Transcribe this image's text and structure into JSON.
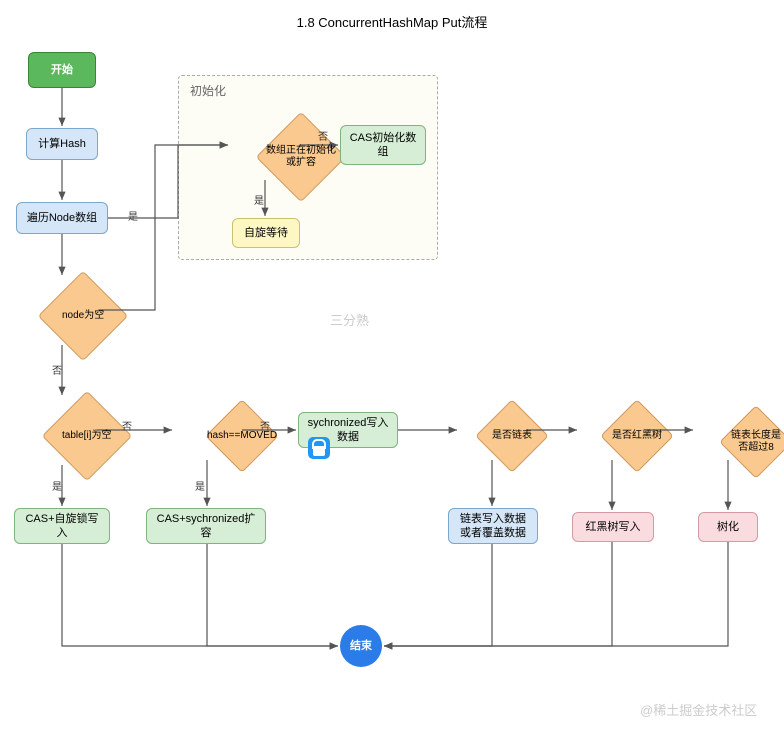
{
  "chart_data": {
    "type": "flowchart",
    "title": "1.8 ConcurrentHashMap Put流程",
    "nodes": [
      {
        "id": "start",
        "type": "terminator",
        "label": "开始"
      },
      {
        "id": "calc_hash",
        "type": "process",
        "label": "计算Hash"
      },
      {
        "id": "iterate",
        "type": "process",
        "label": "遍历Node数组"
      },
      {
        "id": "node_empty",
        "type": "decision",
        "label": "node为空"
      },
      {
        "id": "init_group",
        "type": "container",
        "label": "初始化"
      },
      {
        "id": "init_decide",
        "type": "decision",
        "label": "数组正在初始化或扩容"
      },
      {
        "id": "cas_init",
        "type": "process",
        "label": "CAS初始化数组"
      },
      {
        "id": "spin_wait",
        "type": "process",
        "label": "自旋等待"
      },
      {
        "id": "table_empty",
        "type": "decision",
        "label": "table[i]为空"
      },
      {
        "id": "hash_moved",
        "type": "decision",
        "label": "hash==MOVED"
      },
      {
        "id": "sync_write",
        "type": "process",
        "label": "sychronized写入数据"
      },
      {
        "id": "is_list",
        "type": "decision",
        "label": "是否链表"
      },
      {
        "id": "is_rbtree",
        "type": "decision",
        "label": "是否红黑树"
      },
      {
        "id": "len_gt8",
        "type": "decision",
        "label": "链表长度是否超过8"
      },
      {
        "id": "cas_spin_write",
        "type": "process",
        "label": "CAS+自旋锁写入"
      },
      {
        "id": "cas_sync_resize",
        "type": "process",
        "label": "CAS+sychronized扩容"
      },
      {
        "id": "list_write",
        "type": "process",
        "label": "链表写入数据或者覆盖数据"
      },
      {
        "id": "rbtree_write",
        "type": "process",
        "label": "红黑树写入"
      },
      {
        "id": "treeify",
        "type": "process",
        "label": "树化"
      },
      {
        "id": "end",
        "type": "terminator",
        "label": "结束"
      }
    ],
    "edges": [
      {
        "from": "start",
        "to": "calc_hash"
      },
      {
        "from": "calc_hash",
        "to": "iterate"
      },
      {
        "from": "iterate",
        "to": "node_empty"
      },
      {
        "from": "node_empty",
        "to": "init_decide",
        "label": "是"
      },
      {
        "from": "init_decide",
        "to": "cas_init",
        "label": "否"
      },
      {
        "from": "init_decide",
        "to": "spin_wait",
        "label": "是"
      },
      {
        "from": "node_empty",
        "to": "table_empty",
        "label": "否"
      },
      {
        "from": "table_empty",
        "to": "cas_spin_write",
        "label": "是"
      },
      {
        "from": "table_empty",
        "to": "hash_moved",
        "label": "否"
      },
      {
        "from": "hash_moved",
        "to": "cas_sync_resize",
        "label": "是"
      },
      {
        "from": "hash_moved",
        "to": "sync_write",
        "label": "否"
      },
      {
        "from": "sync_write",
        "to": "is_list"
      },
      {
        "from": "is_list",
        "to": "list_write"
      },
      {
        "from": "is_list",
        "to": "is_rbtree"
      },
      {
        "from": "is_rbtree",
        "to": "rbtree_write"
      },
      {
        "from": "is_rbtree",
        "to": "len_gt8"
      },
      {
        "from": "len_gt8",
        "to": "treeify"
      },
      {
        "from": "cas_spin_write",
        "to": "end"
      },
      {
        "from": "cas_sync_resize",
        "to": "end"
      },
      {
        "from": "list_write",
        "to": "end"
      },
      {
        "from": "rbtree_write",
        "to": "end"
      },
      {
        "from": "treeify",
        "to": "end"
      }
    ]
  },
  "labels": {
    "yes": "是",
    "no": "否"
  },
  "title": "1.8 ConcurrentHashMap Put流程",
  "watermark1": "三分熟",
  "watermark2": "@稀土掘金技术社区"
}
